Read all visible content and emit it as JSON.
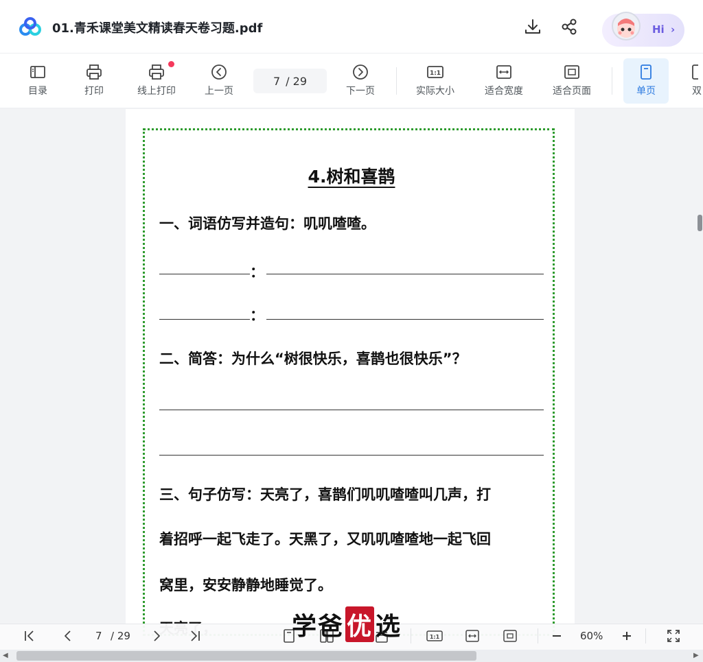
{
  "header": {
    "file_title": "01.青禾课堂美文精读春天卷习题.pdf",
    "hi_label": "Hi",
    "hi_chevron": "›"
  },
  "toolbar": {
    "toc": "目录",
    "print": "打印",
    "online_print": "线上打印",
    "prev_page": "上一页",
    "current_page": "7",
    "total_pages": "/ 29",
    "next_page": "下一页",
    "actual_size": "实际大小",
    "fit_width": "适合宽度",
    "fit_page": "适合页面",
    "single_page": "单页",
    "double_page": "双"
  },
  "document": {
    "title": "4.树和喜鹊",
    "q1": "一、词语仿写并造句：叽叽喳喳。",
    "colon": "：",
    "q2": "二、简答：为什么“树很快乐，喜鹊也很快乐”？",
    "q3_line1": "三、句子仿写：天亮了，喜鹊们叽叽喳喳叫几声，打",
    "q3_line2": "着招呼一起飞走了。天黑了，又叽叽喳喳地一起飞回",
    "q3_line3": "窝里，安安静静地睡觉了。",
    "q3_line4": "天亮了，"
  },
  "watermark": {
    "part1": "学爸",
    "part2": "优",
    "part3": "选"
  },
  "bottombar": {
    "current_page": "7",
    "total_pages": "/ 29",
    "zoom": "60%",
    "actual_size_icon_text": "1:1"
  },
  "colors": {
    "accent": "#2b7ae0",
    "frame_green": "#2e9b2e",
    "notify_red": "#f5395c",
    "hi_purple": "#6b5ce0"
  }
}
